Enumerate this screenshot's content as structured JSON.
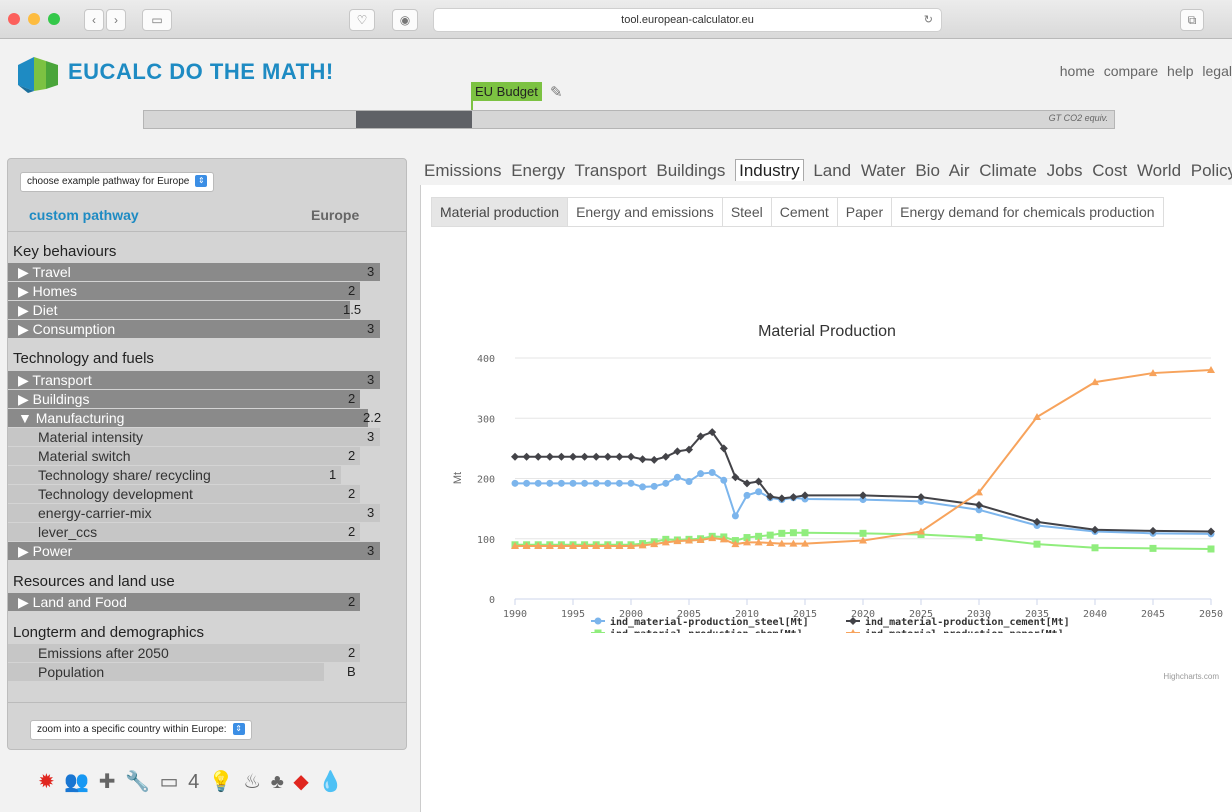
{
  "browser": {
    "url": "tool.european-calculator.eu"
  },
  "header": {
    "brand": "EUCALC DO THE MATH!",
    "nav": [
      "home",
      "compare",
      "help",
      "legal"
    ],
    "budget_label": "EU Budget",
    "gauge_unit": "GT CO2 equiv."
  },
  "sidebar": {
    "pathway_select": "choose example pathway for Europe",
    "custom_label": "custom pathway",
    "region_label": "Europe",
    "groups": [
      {
        "title": "Key behaviours",
        "levers": [
          {
            "label": "Travel",
            "value": "3"
          },
          {
            "label": "Homes",
            "value": "2"
          },
          {
            "label": "Diet",
            "value": "1.5"
          },
          {
            "label": "Consumption",
            "value": "3"
          }
        ]
      },
      {
        "title": "Technology and fuels",
        "levers": [
          {
            "label": "Transport",
            "value": "3"
          },
          {
            "label": "Buildings",
            "value": "2"
          },
          {
            "label": "Manufacturing",
            "value": "2.2"
          },
          {
            "label": "Material intensity",
            "value": "3"
          },
          {
            "label": "Material switch",
            "value": "2"
          },
          {
            "label": "Technology share/ recycling",
            "value": "1"
          },
          {
            "label": "Technology development",
            "value": "2"
          },
          {
            "label": "energy-carrier-mix",
            "value": "3"
          },
          {
            "label": "lever_ccs",
            "value": "2"
          },
          {
            "label": "Power",
            "value": "3"
          }
        ]
      },
      {
        "title": "Resources and land use",
        "levers": [
          {
            "label": "Land and Food",
            "value": "2"
          }
        ]
      },
      {
        "title": "Longterm and demographics",
        "levers": [
          {
            "label": "Emissions after 2050",
            "value": "2"
          },
          {
            "label": "Population",
            "value": "B"
          }
        ]
      }
    ],
    "zoom_select": "zoom into a specific country within Europe:"
  },
  "tabs": [
    "Emissions",
    "Energy",
    "Transport",
    "Buildings",
    "Industry",
    "Land",
    "Water",
    "Bio",
    "Air",
    "Climate",
    "Jobs",
    "Cost",
    "World",
    "Policy"
  ],
  "active_tab": "Industry",
  "subtabs": [
    "Material production",
    "Energy and emissions",
    "Steel",
    "Cement",
    "Paper",
    "Energy demand for chemicals production"
  ],
  "credit": "Highcharts.com",
  "chart_data": {
    "type": "line",
    "title": "Material Production",
    "ylabel": "Mt",
    "xlabel": "",
    "ylim": [
      0,
      400
    ],
    "yticks": [
      0,
      100,
      200,
      300,
      400
    ],
    "xticks": [
      1990,
      1995,
      2000,
      2005,
      2010,
      2015,
      2020,
      2025,
      2030,
      2035,
      2040,
      2045,
      2050
    ],
    "x": [
      1990,
      1991,
      1992,
      1993,
      1994,
      1995,
      1996,
      1997,
      1998,
      1999,
      2000,
      2001,
      2002,
      2003,
      2004,
      2005,
      2006,
      2007,
      2008,
      2009,
      2010,
      2011,
      2012,
      2013,
      2014,
      2015,
      2020,
      2025,
      2030,
      2035,
      2040,
      2045,
      2050
    ],
    "legend_position": "bottom",
    "series": [
      {
        "name": "ind_material-production_steel[Mt]",
        "color": "#7cb5ec",
        "marker": "circle",
        "values": [
          192,
          192,
          192,
          192,
          192,
          192,
          192,
          192,
          192,
          192,
          192,
          186,
          187,
          192,
          202,
          195,
          208,
          210,
          197,
          138,
          172,
          178,
          168,
          165,
          168,
          166,
          165,
          162,
          148,
          122,
          112,
          109,
          108
        ]
      },
      {
        "name": "ind_material-production_cement[Mt]",
        "color": "#434348",
        "marker": "diamond",
        "values": [
          236,
          236,
          236,
          236,
          236,
          236,
          236,
          236,
          236,
          236,
          236,
          232,
          231,
          236,
          245,
          248,
          270,
          277,
          250,
          202,
          192,
          195,
          170,
          167,
          169,
          172,
          172,
          169,
          156,
          128,
          115,
          113,
          112
        ]
      },
      {
        "name": "ind_material-production_chem[Mt]",
        "color": "#90ed7d",
        "marker": "square",
        "values": [
          90,
          90,
          90,
          90,
          90,
          90,
          90,
          90,
          90,
          90,
          90,
          92,
          95,
          99,
          98,
          99,
          100,
          104,
          103,
          97,
          102,
          104,
          106,
          109,
          110,
          110,
          109,
          107,
          102,
          91,
          85,
          84,
          83
        ]
      },
      {
        "name": "ind_material-production_paper[Mt]",
        "color": "#f7a35c",
        "marker": "triangle",
        "values": [
          88,
          88,
          88,
          88,
          88,
          88,
          88,
          88,
          88,
          88,
          88,
          89,
          91,
          94,
          96,
          97,
          98,
          101,
          99,
          91,
          94,
          94,
          93,
          92,
          92,
          92,
          97,
          112,
          177,
          302,
          360,
          375,
          380
        ]
      }
    ]
  }
}
